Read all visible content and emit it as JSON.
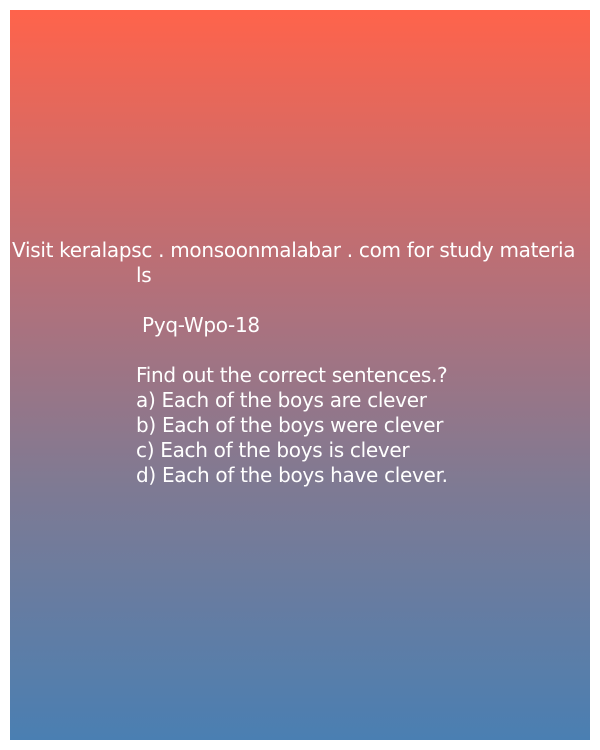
{
  "visit_line_1": "Visit keralapsc . monsoonmalabar . com for study materia",
  "visit_line_2": "ls",
  "code": " Pyq-Wpo-18",
  "question": "Find out the correct sentences.?",
  "options": [
    "a) Each of the boys are clever",
    "b) Each of the boys were clever",
    "c) Each of the boys is clever",
    "d) Each of the boys have clever."
  ],
  "colors": {
    "gradient_top": "#ff634b",
    "gradient_bottom": "#4a7fb2",
    "text": "#ffffff"
  }
}
